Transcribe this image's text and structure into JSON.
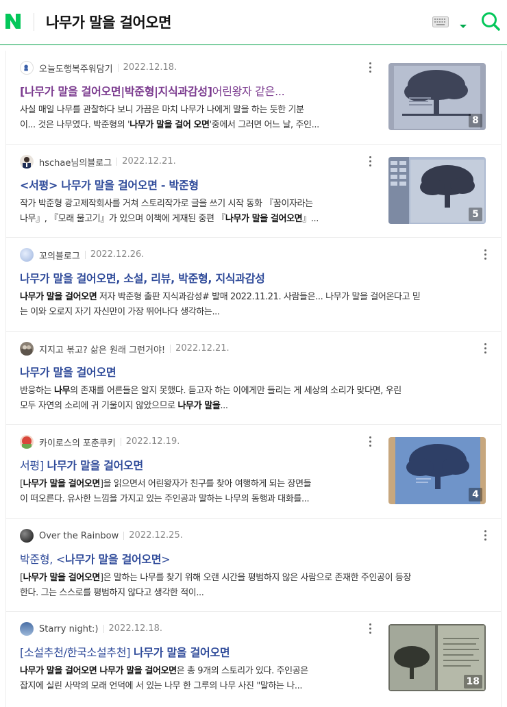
{
  "header": {
    "logo": "N",
    "query": "나무가 말을 걸어오면",
    "icons": [
      "keyboard-icon",
      "chevron-down-icon",
      "search-icon"
    ],
    "accent_color": "#03c75a"
  },
  "results": [
    {
      "author": "오늘도행복주워담기",
      "date": "2022.12.18.",
      "title_bold": "[나무가 말을 걸어오면|박준형|지식과감성]",
      "title_plain": "어린왕자 같은...",
      "snippet_line1": "사실 매일 나무를 관찰하다 보니 가끔은 마치 나무가 나에게 말을 하는 듯한 기분",
      "snippet_line2a": "이... 것은 나무였다. 박준형의 '",
      "snippet_line2b": "나무가 말을 걸어 오면",
      "snippet_line2c": "'중에서 그러면 어느 날, 주인...",
      "image_count": "8"
    },
    {
      "author": "hschae님의블로그",
      "date": "2022.12.21.",
      "title": "<서평> 나무가 말을 걸어오면 - 박준형",
      "snippet_line1": "작가 박준형 광고제작회사를 거쳐 스토리작가로 글을 쓰기 시작 동화 『꿈이자라는",
      "snippet_line2a": "나무』, 『모래 물고기』가 있으며 이책에 게재된 중편 『",
      "snippet_line2b": "나무가 말을 걸어오면",
      "snippet_line2c": "』...",
      "image_count": "5"
    },
    {
      "author": "꼬의블로그",
      "date": "2022.12.26.",
      "title": "나무가 말을 걸어오면, 소설, 리뷰, 박준형, 지식과감성",
      "snippet_line1a": "나무가 말을 걸어오면",
      "snippet_line1b": " 저자 박준형 출판 지식과감성# 발매 2022.11.21. 사람들은... 나무가 말을 걸어온다고 믿",
      "snippet_line2": "는 이와 오로지 자기 자신만이 가장 뛰어나다 생각하는..."
    },
    {
      "author": "지지고 볶고? 삶은 원래 그런거야!",
      "date": "2022.12.21.",
      "title": "나무가 말을 걸어오면",
      "snippet_line1a": "반응하는 ",
      "snippet_line1b": "나무",
      "snippet_line1c": "의 존재를 어른들은 알지 못했다. 듣고자 하는 이에게만 들리는 게 세상의 소리가 맞다면, 우린",
      "snippet_line2a": "모두 자연의 소리에 귀 기울이지 않았으므로 ",
      "snippet_line2b": "나무가 말을",
      "snippet_line2c": "..."
    },
    {
      "author": "카이로스의 포춘쿠키",
      "date": "2022.12.19.",
      "title_plain": "서평] ",
      "title_bold": "나무가 말을 걸어오면",
      "snippet_line1a": "[",
      "snippet_line1b": "나무가 말을 걸어오면",
      "snippet_line1c": "]을 읽으면서 어린왕자가 친구를 찾아 여행하게 되는 장면들",
      "snippet_line2": "이 떠오른다. 유사한 느낌을 가지고 있는 주인공과 말하는 나무의 동행과 대화를...",
      "image_count": "4"
    },
    {
      "author": "Over the Rainbow",
      "date": "2022.12.25.",
      "title_plain": "박준형, <",
      "title_bold": "나무가 말을 걸어오면",
      "title_end": ">",
      "snippet_line1a": "[",
      "snippet_line1b": "나무가 말을 걸어오면",
      "snippet_line1c": "]은 말하는 나무를 찾기 위해 오랜 시간을 평범하지 않은 사람으로 존재한 주인공이 등장",
      "snippet_line2": "한다. 그는 스스로를 평범하지 않다고 생각한 적이..."
    },
    {
      "author": "Starry night:)",
      "date": "2022.12.18.",
      "title_plain": "[소설추천/한국소설추천] ",
      "title_bold": "나무가 말을 걸어오면",
      "snippet_line1a": "나무가 말을 걸어오면 나무가 말을 걸어오면",
      "snippet_line1b": "은 총 9개의 스토리가 있다. 주인공은",
      "snippet_line2": "잡지에 실린 사막의 모래 언덕에 서 있는 나무 한 그루의 나무 사진 \"말하는 나...",
      "image_count": "18"
    }
  ]
}
